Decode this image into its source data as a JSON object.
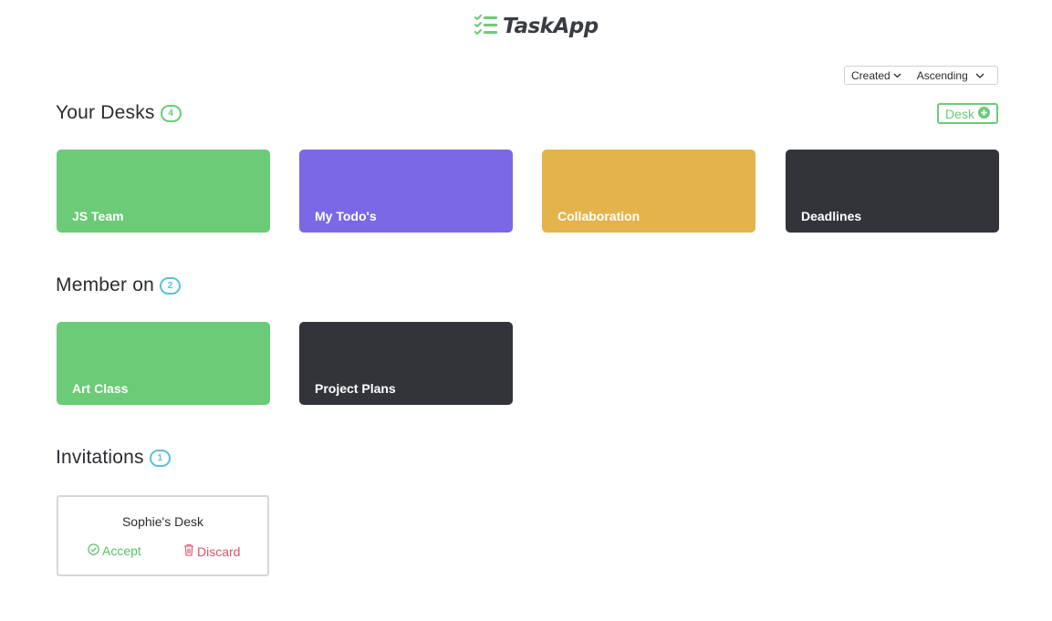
{
  "app": {
    "name": "TaskApp",
    "logo_icon": "checklist-icon"
  },
  "sort": {
    "field": "Created",
    "order": "Ascending"
  },
  "colors": {
    "green": "#6bcb77",
    "purple": "#7b68e6",
    "gold": "#e4b34c",
    "dark": "#33343a",
    "blue": "#5bc0de",
    "red": "#d9536f"
  },
  "your_desks": {
    "title": "Your Desks",
    "count": "4",
    "add_label": "Desk",
    "items": [
      {
        "name": "JS Team",
        "color": "#6bcb77"
      },
      {
        "name": "My Todo's",
        "color": "#7b68e6"
      },
      {
        "name": "Collaboration",
        "color": "#e4b34c"
      },
      {
        "name": "Deadlines",
        "color": "#33343a"
      }
    ]
  },
  "member_on": {
    "title": "Member on",
    "count": "2",
    "items": [
      {
        "name": "Art Class",
        "color": "#6bcb77"
      },
      {
        "name": "Project Plans",
        "color": "#33343a"
      }
    ]
  },
  "invitations": {
    "title": "Invitations",
    "count": "1",
    "items": [
      {
        "desk_name": "Sophie's Desk",
        "accept_label": "Accept",
        "discard_label": "Discard"
      }
    ]
  }
}
